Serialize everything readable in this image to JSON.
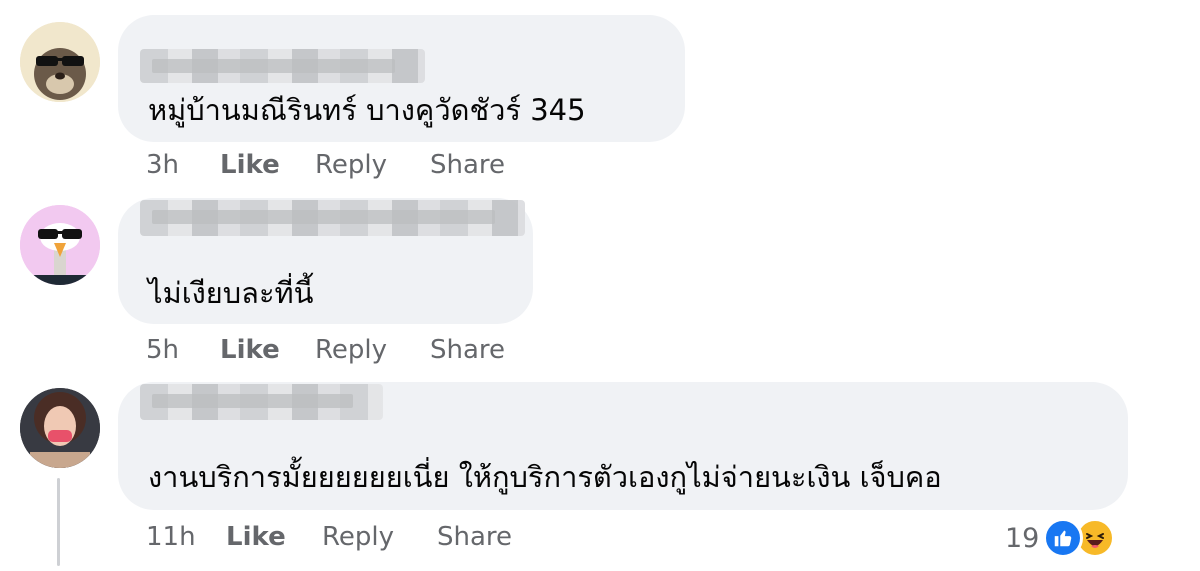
{
  "comments": [
    {
      "text": "หมู่บ้านมณีรินทร์ บางคูวัดชัวร์ 345",
      "time": "3h",
      "like": "Like",
      "reply": "Reply",
      "share": "Share"
    },
    {
      "text": "ไม่เงียบละที่นี้",
      "time": "5h",
      "like": "Like",
      "reply": "Reply",
      "share": "Share"
    },
    {
      "text": "งานบริการมั้ยยยยยยเนี่ย ให้กูบริการตัวเองกูไม่จ่ายนะเงิน เจ็บคอ",
      "time": "11h",
      "like": "Like",
      "reply": "Reply",
      "share": "Share",
      "reaction_count": "19",
      "reaction_icons": [
        "like-icon",
        "haha-icon"
      ]
    }
  ],
  "colors": {
    "bubble": "#f0f2f5",
    "meta_text": "#65676b",
    "like_blue": "#1877f2",
    "haha_yellow": "#f7b928"
  }
}
